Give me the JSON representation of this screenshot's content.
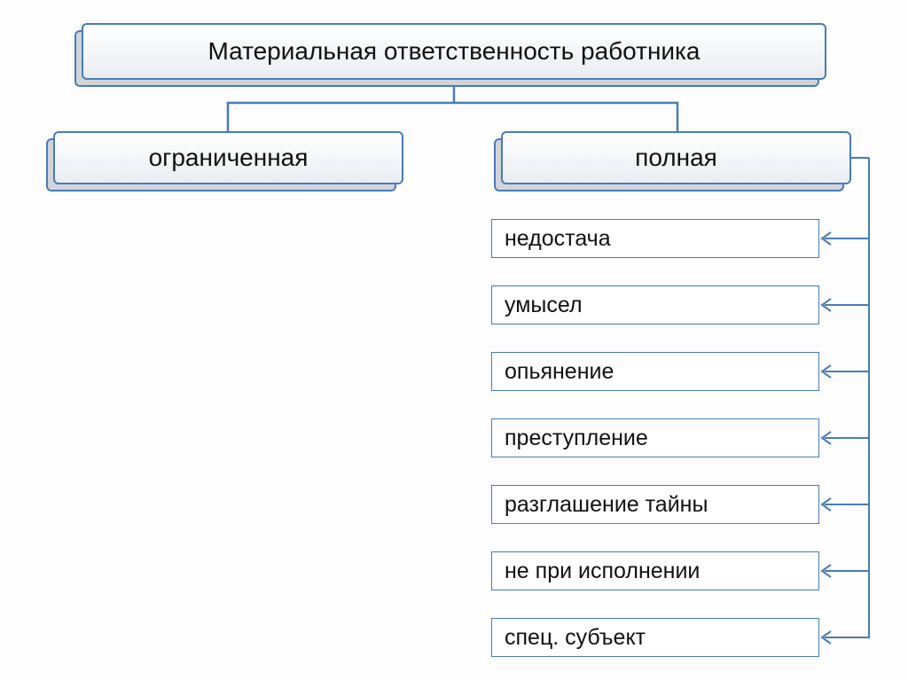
{
  "colors": {
    "border": "#4a7bb5",
    "shadow": "#d0d5da"
  },
  "root": {
    "label": "Материальная ответственность работника"
  },
  "branches": [
    {
      "label": "ограниченная"
    },
    {
      "label": "полная"
    }
  ],
  "leaves": [
    {
      "label": "недостача"
    },
    {
      "label": "умысел"
    },
    {
      "label": "опьянение"
    },
    {
      "label": "преступление"
    },
    {
      "label": "разглашение тайны"
    },
    {
      "label": "не при исполнении"
    },
    {
      "label": "спец. субъект"
    }
  ]
}
